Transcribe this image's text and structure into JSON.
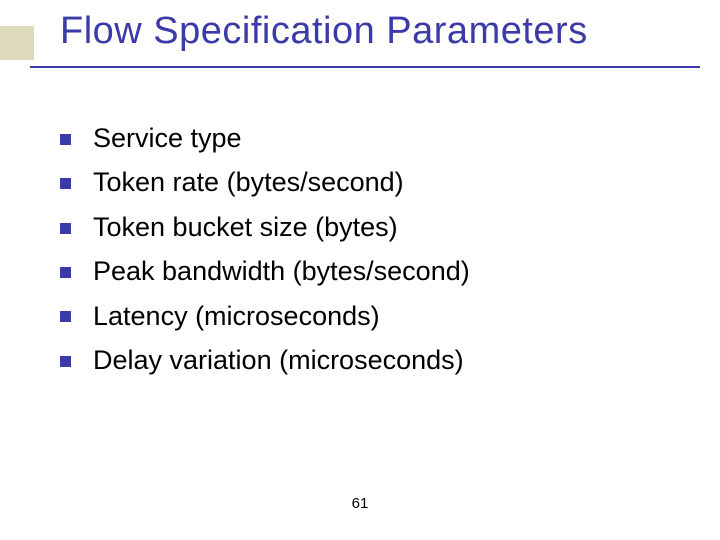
{
  "title": "Flow Specification Parameters",
  "items": [
    "Service type",
    "Token rate (bytes/second)",
    "Token bucket size (bytes)",
    "Peak bandwidth (bytes/second)",
    "Latency (microseconds)",
    "Delay variation (microseconds)"
  ],
  "page_number": "61"
}
